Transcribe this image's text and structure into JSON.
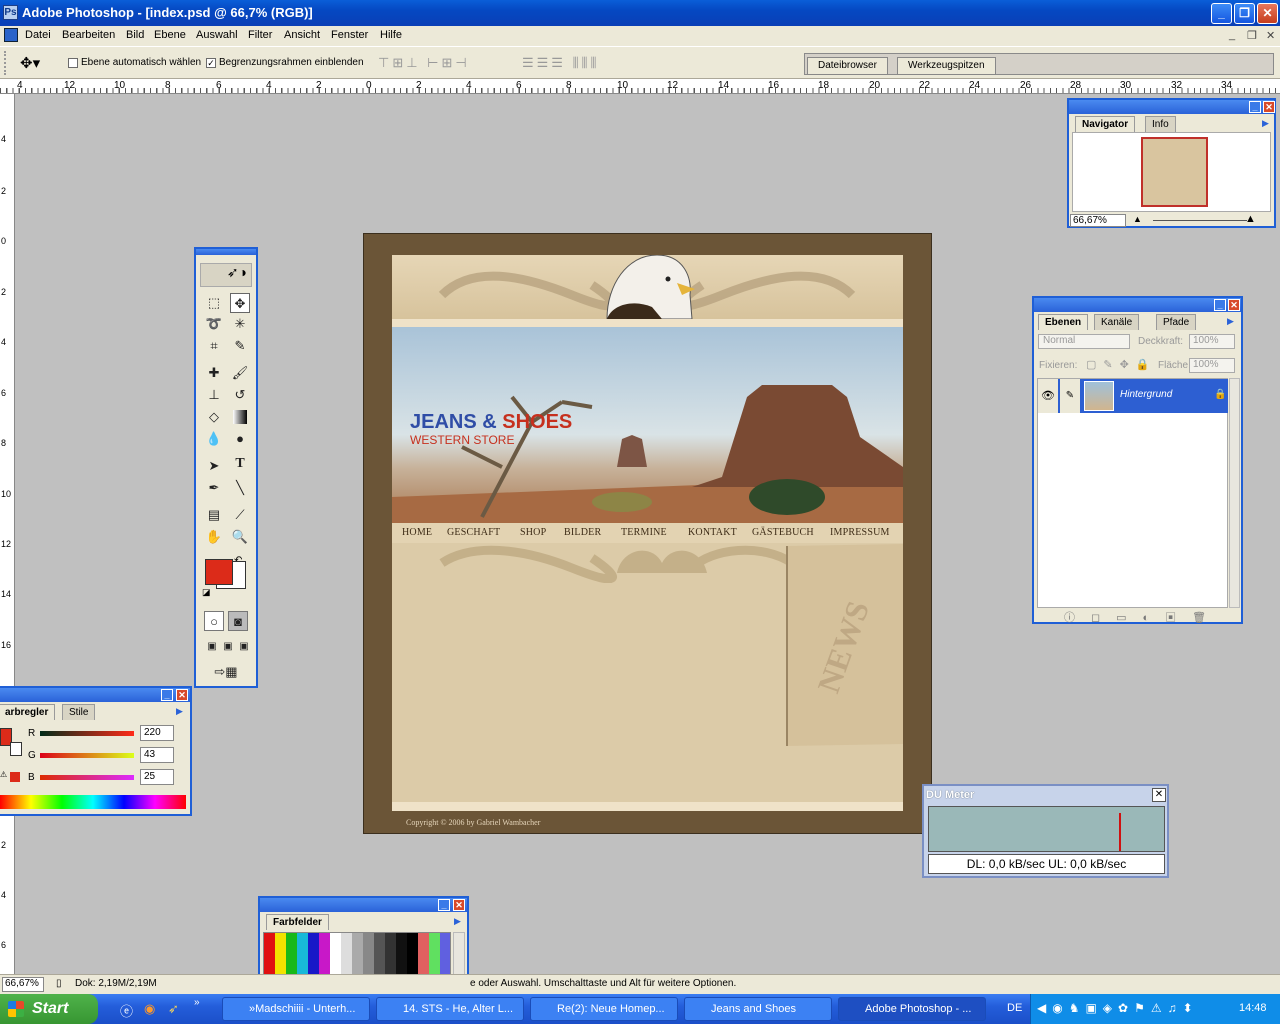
{
  "window": {
    "title": "Adobe Photoshop - [index.psd @ 66,7% (RGB)]",
    "minimize": "_",
    "maximize": "❐",
    "close": "✕"
  },
  "menu": {
    "items": [
      "Datei",
      "Bearbeiten",
      "Bild",
      "Ebene",
      "Auswahl",
      "Filter",
      "Ansicht",
      "Fenster",
      "Hilfe"
    ]
  },
  "options": {
    "auto_select_label": "Ebene automatisch wählen",
    "auto_select_checked": false,
    "bounding_box_label": "Begrenzungsrahmen einblenden",
    "bounding_box_checked": true,
    "well_tabs": [
      "Dateibrowser",
      "Werkzeugspitzen"
    ]
  },
  "ruler": {
    "h_labels": [
      "4",
      "12",
      "10",
      "8",
      "6",
      "4",
      "2",
      "0",
      "2",
      "4",
      "6",
      "8",
      "10",
      "12",
      "14",
      "16",
      "18",
      "20",
      "22",
      "24",
      "26",
      "28",
      "30",
      "32",
      "34"
    ],
    "v_labels": [
      "4",
      "2",
      "0",
      "2",
      "4",
      "6",
      "8",
      "10",
      "12",
      "14",
      "16",
      "18",
      "2",
      "4",
      "6"
    ]
  },
  "document": {
    "brand_part1": "JEANS & ",
    "brand_part2": "SHOES",
    "brand_sub": "WESTERN STORE",
    "nav": [
      "HOME",
      "GESCHAFT",
      "SHOP",
      "BILDER",
      "TERMINE",
      "KONTAKT",
      "GÄSTEBUCH",
      "IMPRESSUM"
    ],
    "news_label": "NEWS",
    "copyright": "Copyright © 2006 by Gabriel Wambacher"
  },
  "navigator": {
    "tabs": [
      "Navigator",
      "Info"
    ],
    "zoom": "66,67%"
  },
  "layers": {
    "tabs": [
      "Ebenen",
      "Kanäle",
      "Pfade"
    ],
    "blend_mode": "Normal",
    "opacity_label": "Deckkraft:",
    "opacity_value": "100%",
    "lock_label": "Fixieren:",
    "fill_label": "Fläche",
    "fill_value": "100%",
    "layer_name": "Hintergrund"
  },
  "color_panel": {
    "tabs": [
      "arbregler",
      "Stile"
    ],
    "r_label": "R",
    "g_label": "G",
    "b_label": "B",
    "r": "220",
    "g": "43",
    "b": "25",
    "fg_color": "#dc2b19"
  },
  "swatches": {
    "tab": "Farbfelder"
  },
  "du_meter": {
    "title": "DU Meter",
    "readout": "DL: 0,0 kB/sec  UL: 0,0 kB/sec"
  },
  "status": {
    "zoom": "66,67%",
    "doc": "Dok: 2,19M/2,19M",
    "hint": "e oder Auswahl. Umschalttaste und Alt für weitere Optionen."
  },
  "taskbar": {
    "start": "Start",
    "tasks": [
      "»Madschiiii - Unterh...",
      "14. STS - He, Alter L...",
      "Re(2): Neue Homep...",
      "Jeans and Shoes",
      "Adobe Photoshop - ..."
    ],
    "lang": "DE",
    "clock": "14:48"
  },
  "colors": {
    "accent": "#0548c2",
    "brand_blue": "#2f4da6",
    "brand_red": "#c6301e"
  }
}
